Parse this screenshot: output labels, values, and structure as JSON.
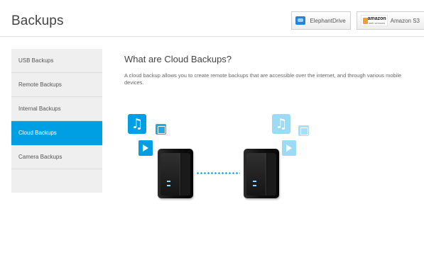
{
  "header": {
    "title": "Backups",
    "providers": [
      {
        "label": "ElephantDrive",
        "icon": "elephantdrive-logo-icon"
      },
      {
        "label": "Amazon S3",
        "icon": "amazon-web-services-logo-icon",
        "logo_word": "amazon",
        "logo_sub": "web services"
      }
    ]
  },
  "sidebar": {
    "items": [
      {
        "label": "USB Backups",
        "active": false
      },
      {
        "label": "Remote Backups",
        "active": false
      },
      {
        "label": "Internal Backups",
        "active": false
      },
      {
        "label": "Cloud Backups",
        "active": true
      },
      {
        "label": "Camera Backups",
        "active": false
      }
    ]
  },
  "main": {
    "heading": "What are Cloud Backups?",
    "description": "A cloud backup allows you to create remote backups that are accessible over the internet, and through various mobile devices."
  },
  "illustration": {
    "icons": [
      "music-note-icon",
      "photo-icon",
      "video-icon",
      "nas-device-icon",
      "dotted-link-icon"
    ]
  },
  "colors": {
    "accent": "#009fe3",
    "sidebar_bg": "#efefef",
    "text": "#444444"
  }
}
